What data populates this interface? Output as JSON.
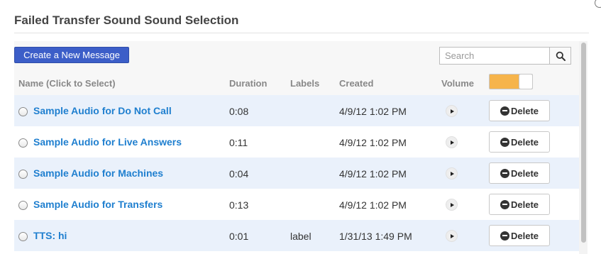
{
  "dialog": {
    "title": "Failed Transfer Sound Sound Selection"
  },
  "toolbar": {
    "create_label": "Create a New Message",
    "search_placeholder": "Search",
    "search_value": "",
    "search_icon": "search-icon"
  },
  "table": {
    "columns": {
      "name": "Name (Click to Select)",
      "duration": "Duration",
      "labels": "Labels",
      "created": "Created",
      "volume": "Volume"
    },
    "volume_toggle": "on",
    "rows": [
      {
        "name": "Sample Audio for Do Not Call",
        "duration": "0:08",
        "label": "",
        "created": "4/9/12 1:02 PM",
        "delete_label": "Delete"
      },
      {
        "name": "Sample Audio for Live Answers",
        "duration": "0:11",
        "label": "",
        "created": "4/9/12 1:02 PM",
        "delete_label": "Delete"
      },
      {
        "name": "Sample Audio for Machines",
        "duration": "0:04",
        "label": "",
        "created": "4/9/12 1:02 PM",
        "delete_label": "Delete"
      },
      {
        "name": "Sample Audio for Transfers",
        "duration": "0:13",
        "label": "",
        "created": "4/9/12 1:02 PM",
        "delete_label": "Delete"
      },
      {
        "name": "TTS: hi",
        "duration": "0:01",
        "label": "label",
        "created": "1/31/13 1:49 PM",
        "delete_label": "Delete"
      }
    ]
  },
  "colors": {
    "accent": "#3c5ec8",
    "link": "#1f7fcf",
    "row_alt": "#eaf1fb",
    "toggle": "#f6b44b"
  }
}
